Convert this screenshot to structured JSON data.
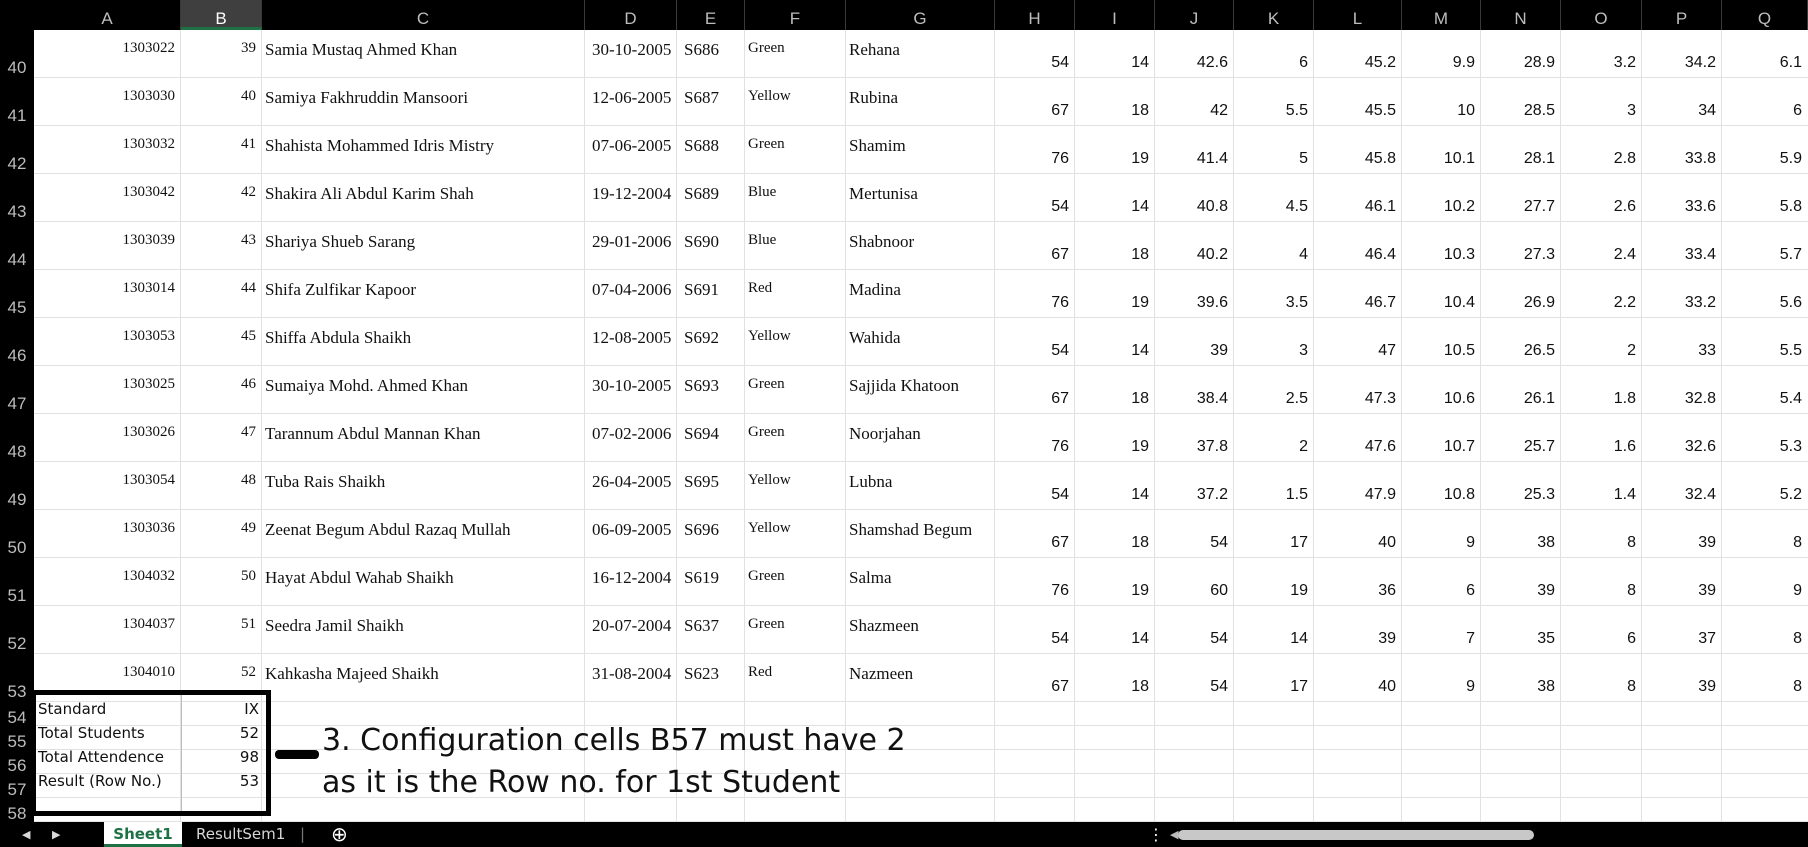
{
  "columns": [
    "A",
    "B",
    "C",
    "D",
    "E",
    "F",
    "G",
    "H",
    "I",
    "J",
    "K",
    "L",
    "M",
    "N",
    "O",
    "P",
    "Q"
  ],
  "selected_column": "B",
  "row_numbers": [
    40,
    41,
    42,
    43,
    44,
    45,
    46,
    47,
    48,
    49,
    50,
    51,
    52,
    53,
    54,
    55,
    56,
    57,
    58
  ],
  "rows": [
    [
      "1303022",
      "39",
      "Samia Mustaq Ahmed Khan",
      "30-10-2005",
      "S686",
      "Green",
      "Rehana",
      "54",
      "14",
      "42.6",
      "6",
      "45.2",
      "9.9",
      "28.9",
      "3.2",
      "34.2",
      "6.1"
    ],
    [
      "1303030",
      "40",
      "Samiya Fakhruddin Mansoori",
      "12-06-2005",
      "S687",
      "Yellow",
      "Rubina",
      "67",
      "18",
      "42",
      "5.5",
      "45.5",
      "10",
      "28.5",
      "3",
      "34",
      "6"
    ],
    [
      "1303032",
      "41",
      "Shahista Mohammed Idris Mistry",
      "07-06-2005",
      "S688",
      "Green",
      "Shamim",
      "76",
      "19",
      "41.4",
      "5",
      "45.8",
      "10.1",
      "28.1",
      "2.8",
      "33.8",
      "5.9"
    ],
    [
      "1303042",
      "42",
      "Shakira Ali Abdul Karim Shah",
      "19-12-2004",
      "S689",
      "Blue",
      "Mertunisa",
      "54",
      "14",
      "40.8",
      "4.5",
      "46.1",
      "10.2",
      "27.7",
      "2.6",
      "33.6",
      "5.8"
    ],
    [
      "1303039",
      "43",
      "Shariya Shueb Sarang",
      "29-01-2006",
      "S690",
      "Blue",
      "Shabnoor",
      "67",
      "18",
      "40.2",
      "4",
      "46.4",
      "10.3",
      "27.3",
      "2.4",
      "33.4",
      "5.7"
    ],
    [
      "1303014",
      "44",
      "Shifa Zulfikar Kapoor",
      "07-04-2006",
      "S691",
      "Red",
      "Madina",
      "76",
      "19",
      "39.6",
      "3.5",
      "46.7",
      "10.4",
      "26.9",
      "2.2",
      "33.2",
      "5.6"
    ],
    [
      "1303053",
      "45",
      "Shiffa Abdula Shaikh",
      "12-08-2005",
      "S692",
      "Yellow",
      "Wahida",
      "54",
      "14",
      "39",
      "3",
      "47",
      "10.5",
      "26.5",
      "2",
      "33",
      "5.5"
    ],
    [
      "1303025",
      "46",
      "Sumaiya Mohd. Ahmed Khan",
      "30-10-2005",
      "S693",
      "Green",
      "Sajjida Khatoon",
      "67",
      "18",
      "38.4",
      "2.5",
      "47.3",
      "10.6",
      "26.1",
      "1.8",
      "32.8",
      "5.4"
    ],
    [
      "1303026",
      "47",
      "Tarannum Abdul Mannan Khan",
      "07-02-2006",
      "S694",
      "Green",
      "Noorjahan",
      "76",
      "19",
      "37.8",
      "2",
      "47.6",
      "10.7",
      "25.7",
      "1.6",
      "32.6",
      "5.3"
    ],
    [
      "1303054",
      "48",
      "Tuba Rais Shaikh",
      "26-04-2005",
      "S695",
      "Yellow",
      "Lubna",
      "54",
      "14",
      "37.2",
      "1.5",
      "47.9",
      "10.8",
      "25.3",
      "1.4",
      "32.4",
      "5.2"
    ],
    [
      "1303036",
      "49",
      "Zeenat Begum Abdul Razaq Mullah",
      "06-09-2005",
      "S696",
      "Yellow",
      "Shamshad Begum",
      "67",
      "18",
      "54",
      "17",
      "40",
      "9",
      "38",
      "8",
      "39",
      "8"
    ],
    [
      "1304032",
      "50",
      "Hayat Abdul Wahab Shaikh",
      "16-12-2004",
      "S619",
      "Green",
      "Salma",
      "76",
      "19",
      "60",
      "19",
      "36",
      "6",
      "39",
      "8",
      "39",
      "9"
    ],
    [
      "1304037",
      "51",
      "Seedra Jamil Shaikh",
      "20-07-2004",
      "S637",
      "Green",
      "Shazmeen",
      "54",
      "14",
      "54",
      "14",
      "39",
      "7",
      "35",
      "6",
      "37",
      "8"
    ],
    [
      "1304010",
      "52",
      "Kahkasha Majeed Shaikh",
      "31-08-2004",
      "S623",
      "Red",
      "Nazmeen",
      "67",
      "18",
      "54",
      "17",
      "40",
      "9",
      "38",
      "8",
      "39",
      "8"
    ]
  ],
  "config": [
    {
      "label": "Standard",
      "value": "IX"
    },
    {
      "label": "Total Students",
      "value": "52"
    },
    {
      "label": "Total Attendence",
      "value": "98"
    },
    {
      "label": "Result (Row No.)",
      "value": "53"
    }
  ],
  "annotation": {
    "line1": "3. Configuration cells B57 must have 2",
    "line2": "as it is the Row no. for 1st Student"
  },
  "sheet_tabs": [
    {
      "label": "Sheet1",
      "active": true
    },
    {
      "label": "ResultSem1",
      "active": false
    }
  ],
  "nav": {
    "prev": "◀",
    "next": "▶",
    "add": "⊕",
    "more": "⋮",
    "scroll_left": "◀"
  }
}
